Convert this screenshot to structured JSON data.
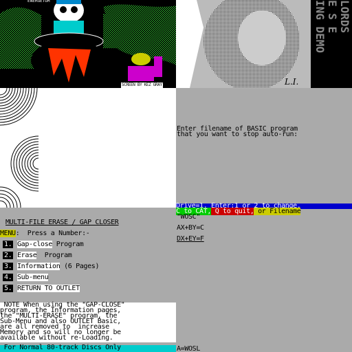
{
  "screens": {
    "cauldron": {
      "credit": "SCREEN BY KEZ GRAY",
      "top_caption": "ENERGETUM"
    },
    "demo": {
      "side_text": "LORDS\nE S E\nING DEMO",
      "signature": "L.I."
    }
  },
  "basic_prompt": {
    "line1": "Enter filename of BASIC program",
    "line2": "that you want to stop auto-run:"
  },
  "drive_bar": {
    "text": "Drive=1. Enter:1 or 2 to change,"
  },
  "command_bar": {
    "cat": "C to CAT,",
    "quit": " Q to quit,",
    "filename": " or Filename"
  },
  "variables": {
    "wosc": "\"WOSC\"",
    "axby": "AX+BY=C",
    "dxey": "DX+EY=F",
    "awosl": "A=WOSL"
  },
  "menu": {
    "title": "MULTI-FILE ERASE / GAP CLOSER",
    "prompt_label": "MENU",
    "prompt_text": ":  Press a Number:-",
    "items": [
      {
        "num": "1.",
        "label": "Gap-close",
        "rest": " Program"
      },
      {
        "num": "2.",
        "label": "Erase",
        "rest": "  Program"
      },
      {
        "num": "3.",
        "label": "Information",
        "rest": " (6 Pages)"
      },
      {
        "num": "4.",
        "label": "Sub-menu",
        "rest": ""
      },
      {
        "num": "5.",
        "label": "RETURN TO OUTLET",
        "rest": ""
      }
    ]
  },
  "note": {
    "lines": [
      " NOTE When using the \"GAP-CLOSE\"",
      "program, the Information pages,",
      "the \"MULTI-ERASE\" program, the",
      "Sub-Menu and also OUTLET Basic,",
      "are all removed to  increase",
      "Memory and so will no longer be",
      "available without re-Loading."
    ]
  },
  "footer": {
    "text": " For Normal 80-track Discs Only"
  },
  "colors": {
    "grey": "#aaaaaa",
    "cyan": "#00cccc",
    "blue": "#0000cc",
    "green": "#00cc00",
    "red": "#cc0000",
    "yellow": "#cccc00"
  }
}
